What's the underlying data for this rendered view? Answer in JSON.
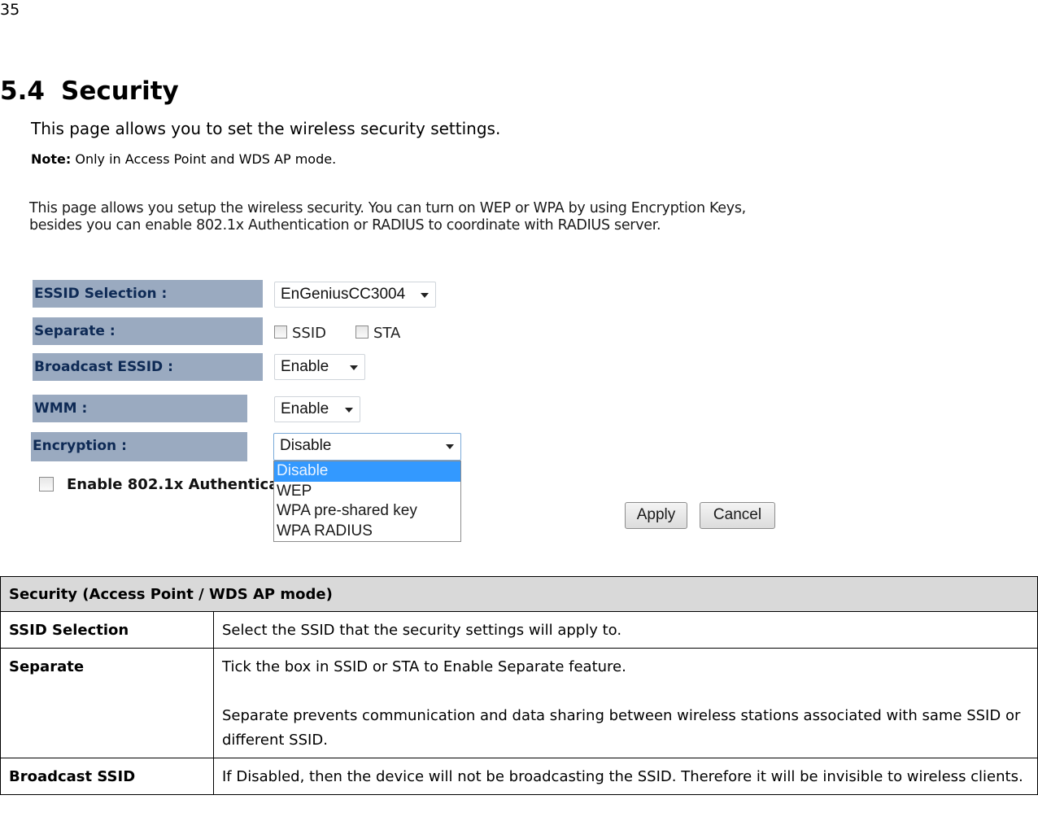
{
  "page_number": "35",
  "section": {
    "number": "5.4",
    "title": "Security",
    "intro": "This page allows you to set the wireless security settings.",
    "note_label": "Note:",
    "note_text": " Only in Access Point and WDS AP mode."
  },
  "screenshot": {
    "description": "This page allows you setup the wireless security. You can turn on WEP or WPA by using Encryption Keys, besides you can enable 802.1x Authentication or RADIUS to coordinate with RADIUS server.",
    "fields": {
      "essid_selection": {
        "label": "ESSID Selection :",
        "value": "EnGeniusCC3004"
      },
      "separate": {
        "label": "Separate :",
        "options": [
          {
            "label": "SSID",
            "checked": false
          },
          {
            "label": "STA",
            "checked": false
          }
        ]
      },
      "broadcast_essid": {
        "label": "Broadcast ESSID :",
        "value": "Enable"
      },
      "wmm": {
        "label": "WMM :",
        "value": "Enable"
      },
      "encryption": {
        "label": "Encryption :",
        "value": "Disable",
        "options": [
          "Disable",
          "WEP",
          "WPA pre-shared key",
          "WPA RADIUS"
        ],
        "selected_index": 0
      },
      "auth_8021x": {
        "label": "Enable 802.1x Authentica",
        "checked": false
      }
    },
    "buttons": {
      "apply": "Apply",
      "cancel": "Cancel"
    },
    "colors": {
      "label_bg": "#9aaac0",
      "label_text": "#0e2a55",
      "dropdown_highlight": "#3399ff"
    }
  },
  "table": {
    "header": "Security (Access Point / WDS AP mode)",
    "rows": [
      {
        "key": "SSID Selection",
        "paragraphs": [
          "Select the SSID that the security settings will apply to."
        ]
      },
      {
        "key": "Separate",
        "paragraphs": [
          "Tick the box in SSID or STA to Enable Separate feature.",
          "Separate prevents communication and data sharing between wireless stations associated with same SSID or different SSID."
        ]
      },
      {
        "key": "Broadcast SSID",
        "paragraphs": [
          "If Disabled, then the device will not be broadcasting the SSID. Therefore it will be invisible to wireless clients."
        ]
      }
    ]
  }
}
